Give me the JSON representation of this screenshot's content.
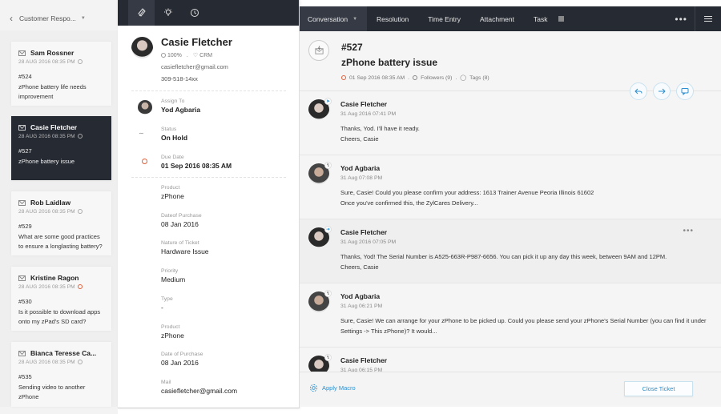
{
  "list": {
    "back_icon": "chevron-left-icon",
    "view_name": "Customer Respo...",
    "tickets": [
      {
        "name": "Sam Rossner",
        "date": "28 AUG 2016 08:35 PM",
        "number": "#524",
        "subject": "zPhone battery life needs improvement",
        "status": "normal",
        "active": false
      },
      {
        "name": "Casie Fletcher",
        "date": "28 AUG 2016 08:35 PM",
        "number": "#527",
        "subject": "zPhone battery issue",
        "status": "normal",
        "active": true
      },
      {
        "name": "Rob Laidlaw",
        "date": "28 AUG 2016 08:35 PM",
        "number": "#529",
        "subject": "What are some good practices to ensure a longlasting battery?",
        "status": "normal",
        "active": false
      },
      {
        "name": "Kristine Ragon",
        "date": "28 AUG 2016 08:35 PM",
        "number": "#530",
        "subject": "Is it possible to download apps onto my zPad's SD card?",
        "status": "overdue",
        "active": false
      },
      {
        "name": "Bianca Teresse Ca...",
        "date": "28 AUG 2016 08:35 PM",
        "number": "#535",
        "subject": "Sending video to another zPhone",
        "status": "normal",
        "active": false
      }
    ]
  },
  "contact": {
    "tabs": [
      {
        "icon": "ticket-properties-icon",
        "active": true
      },
      {
        "icon": "lightbulb-icon",
        "active": false
      },
      {
        "icon": "history-icon",
        "active": false
      }
    ],
    "name": "Casie Fletcher",
    "happiness": "100%",
    "crm": "CRM",
    "email": "casiefletcher@gmail.com",
    "phone": "309-518-14xx",
    "fields": [
      {
        "label": "Assign To",
        "value": "Yod Agbaria"
      },
      {
        "label": "Status",
        "value": "On Hold"
      },
      {
        "label": "Due Date",
        "value": "01 Sep 2016 08:35 AM"
      },
      {
        "label": "Product",
        "value": "zPhone"
      },
      {
        "label": "Dateof Purchase",
        "value": "08 Jan 2016"
      },
      {
        "label": "Nature of Ticket",
        "value": "Hardware Issue"
      },
      {
        "label": "Priority",
        "value": "Medium"
      },
      {
        "label": "Type",
        "value": "-"
      },
      {
        "label": "Product",
        "value": "zPhone"
      },
      {
        "label": "Date of Purchase",
        "value": "08 Jan 2016"
      },
      {
        "label": "Mail",
        "value": "casiefletcher@gmail.com"
      }
    ]
  },
  "main": {
    "tabs": [
      {
        "label": "Conversation",
        "active": true
      },
      {
        "label": "Resolution",
        "active": false
      },
      {
        "label": "Time Entry",
        "active": false
      },
      {
        "label": "Attachment",
        "active": false
      },
      {
        "label": "Task",
        "active": false
      }
    ],
    "ticket": {
      "number": "#527",
      "subject": "zPhone battery issue",
      "due": "01 Sep 2016 08:35 AM",
      "followers": "Followers (9)",
      "tags": "Tags (8)"
    },
    "actions": [
      "reply-icon",
      "forward-icon",
      "comment-icon"
    ],
    "messages": [
      {
        "author": "Casie Fletcher",
        "date": "31 Aug 2016 07:41 PM",
        "lines": [
          "Thanks, Yod. I'll have it ready.",
          "Cheers, Casie"
        ],
        "channel": "twitter",
        "gender": "f"
      },
      {
        "author": "Yod Agbaria",
        "date": "31 Aug 07:08 PM",
        "lines": [
          "Sure, Casie! Could you please confirm your address: 1613 Trainer Avenue Peoria Illinois 61602",
          "Once you've confirmed this, the ZylCares Delivery..."
        ],
        "channel": "agent",
        "gender": "m"
      },
      {
        "author": "Casie Fletcher",
        "date": "31 Aug 2016 07:05 PM",
        "lines": [
          "Thanks, Yod! The Serial Number is A525-663R-P987-6656. You can pick it up any day this week, between 9AM and 12PM.",
          "Cheers, Casie"
        ],
        "channel": "reply",
        "gender": "f"
      },
      {
        "author": "Yod Agbaria",
        "date": "31 Aug 06:21 PM",
        "lines": [
          "Sure, Casie! We can arrange for your zPhone to be picked up. Could you please send your zPhone's Serial Number (you can find it under Settings -> This zPhone)? It would..."
        ],
        "channel": "agent",
        "gender": "m"
      },
      {
        "author": "Casie Fletcher",
        "date": "31 Aug 06:15 PM",
        "lines": [],
        "channel": "agent",
        "gender": "f"
      }
    ],
    "apply_macro": "Apply Macro",
    "close_ticket": "Close Ticket",
    "accent": "#2a8fd0"
  }
}
